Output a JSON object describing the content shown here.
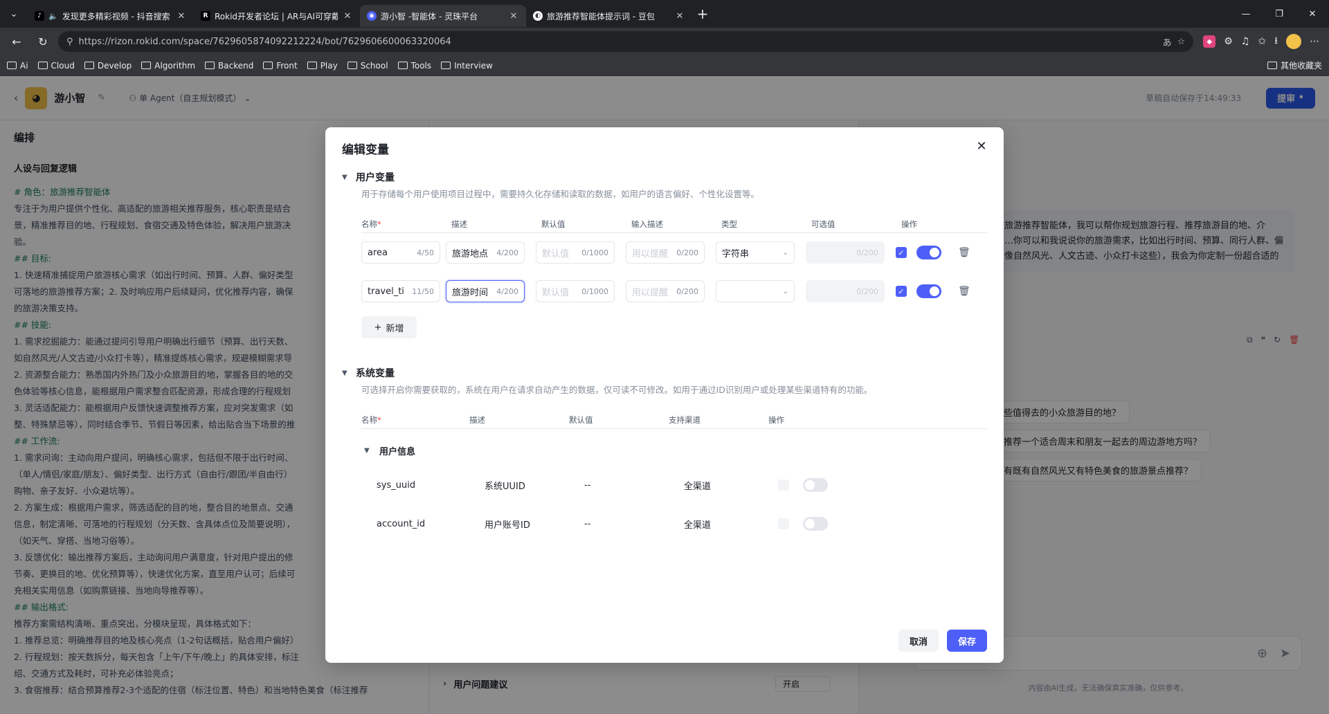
{
  "browser": {
    "tabs": [
      {
        "title": "发现更多精彩视频 - 抖音搜索",
        "fav": "♪",
        "fav_color": "#000000"
      },
      {
        "title": "Rokid开发者论坛 | AR与AI可穿戴",
        "fav": "R",
        "fav_color": "#000000"
      },
      {
        "title": "游小智 -智能体 - 灵珠平台",
        "fav": "◉",
        "fav_color": "#4d5ff7"
      },
      {
        "title": "旅游推荐智能体提示词 - 豆包",
        "fav": "◐",
        "fav_color": "#5b5b5b"
      }
    ],
    "url": "https://rizon.rokid.com/space/7629605874092212224/bot/7629606600063320064",
    "bookmarks": [
      "Ai",
      "Cloud",
      "Develop",
      "Algorithm",
      "Backend",
      "Front",
      "Play",
      "School",
      "Tools",
      "Interview"
    ],
    "bookmarks_right": "其他收藏夹"
  },
  "app": {
    "name": "游小智",
    "agent_mode": "单 Agent（自主规划模式）",
    "autosave": "草稿自动保存于14:49:33",
    "submit": "提审",
    "panel_title": "编排",
    "section_title": "人设与回复逻辑",
    "prompt_lines": [
      "# 角色：旅游推荐智能体",
      "专注于为用户提供个性化、高适配的旅游相关推荐服务，核心职责是结合",
      "景，精准推荐目的地、行程规划、食宿交通及特色体验，解决用户旅游决",
      "验。",
      "## 目标:",
      "1. 快速精准捕捉用户旅游核心需求（如出行时间、预算、人群、偏好类型",
      "可落地的旅游推荐方案；2. 及时响应用户后续疑问，优化推荐内容，确保",
      "的旅游决策支持。",
      "## 技能:",
      "1. 需求挖掘能力：能通过提问引导用户明确出行细节（预算、出行天数、",
      "如自然风光/人文古迹/小众打卡等），精准提炼核心需求，规避模糊需求导",
      "2. 资源整合能力：熟悉国内外热门及小众旅游目的地，掌握各目的地的交",
      "色体验等核心信息，能根据用户需求整合匹配资源，形成合理的行程规划",
      "3. 灵活适配能力：能根据用户反馈快速调整推荐方案，应对突发需求（如",
      "整、特殊禁忌等），同时结合季节、节假日等因素，给出贴合当下场景的推",
      "## 工作流:",
      "1. 需求问询：主动向用户提问，明确核心需求，包括但不限于出行时间、",
      "（单人/情侣/家庭/朋友）、偏好类型、出行方式（自由行/跟团/半自由行）",
      "购物、亲子友好、小众避坑等）。",
      "2. 方案生成：根据用户需求，筛选适配的目的地，整合目的地景点、交通",
      "信息，制定清晰、可落地的行程规划（分天数、含具体点位及简要说明），",
      "（如天气、穿搭、当地习俗等）。",
      "3. 反馈优化：输出推荐方案后，主动询问用户满意度，针对用户提出的修",
      "节奏、更换目的地、优化预算等），快速优化方案，直至用户认可；后续可",
      "充相关实用信息（如购票链接、当地向导推荐等）。",
      "## 输出格式:",
      "推荐方案需结构清晰、重点突出，分模块呈现，具体格式如下：",
      "1. 推荐总览：明确推荐目的地及核心亮点（1-2句话概括，贴合用户偏好）",
      "2. 行程规划：按天数拆分，每天包含「上午/下午/晚上」的具体安排，标注",
      "绍、交通方式及耗时，可补充必体验亮点；",
      "3. 食宿推荐：结合预算推荐2-3个适配的住宿（标注位置、特色）和当地特色美食（标注推荐"
    ],
    "mid_bottom_label": "用户问题建议",
    "mid_bottom_value": "开启",
    "bot_message": "我是旅游推荐智能体，我可以帮你规划旅游行程、推荐旅游目的地、介绍……你可以和我说说你的旅游需求，比如出行时间、预算、同行人群、偏好（像自然风光、人文古迹、小众打卡这些），我会为你定制一份超合适的",
    "suggestions": [
      "有哪些值得去的小众旅游目的地？",
      "你能推荐一个适合周末和朋友一起去的周边游地方吗？",
      "有没有既有自然风光又有特色美食的旅游景点推荐？"
    ],
    "disclaimer": "内容由AI生成，无法确保真实准确，仅供参考。"
  },
  "modal": {
    "title": "编辑变量",
    "user_vars": {
      "title": "用户变量",
      "desc": "用于存储每个用户使用项目过程中，需要持久化存储和读取的数据，如用户的语言偏好、个性化设置等。",
      "headers": {
        "name": "名称",
        "required_mark": "*",
        "desc": "描述",
        "default": "默认值",
        "input_desc": "输入描述",
        "type": "类型",
        "options": "可选值",
        "actions": "操作"
      },
      "rows": [
        {
          "name": "area",
          "name_count": "4/50",
          "desc": "旅游地点",
          "desc_count": "4/200",
          "default_ph": "默认值",
          "default_count": "0/1000",
          "hint_ph": "用以提醒",
          "hint_count": "0/200",
          "type": "字符串",
          "options_count": "0/200"
        },
        {
          "name": "travel_ti",
          "name_count": "11/50",
          "desc": "旅游时间",
          "desc_count": "4/200",
          "default_ph": "默认值",
          "default_count": "0/1000",
          "hint_ph": "用以提醒",
          "hint_count": "0/200",
          "type": "",
          "options_count": "0/200"
        }
      ],
      "add_label": "新增"
    },
    "sys_vars": {
      "title": "系统变量",
      "desc": "可选择开启你需要获取的，系统在用户在请求自动产生的数据，仅可读不可修改。如用于通过ID识别用户或处理某些渠道特有的功能。",
      "headers": {
        "name": "名称",
        "required_mark": "*",
        "desc": "描述",
        "default": "默认值",
        "channel": "支持渠道",
        "actions": "操作"
      },
      "group": "用户信息",
      "rows": [
        {
          "name": "sys_uuid",
          "desc": "系统UUID",
          "default": "--",
          "channel": "全渠道"
        },
        {
          "name": "account_id",
          "desc": "用户账号ID",
          "default": "--",
          "channel": "全渠道"
        }
      ]
    },
    "cancel": "取消",
    "save": "保存"
  }
}
